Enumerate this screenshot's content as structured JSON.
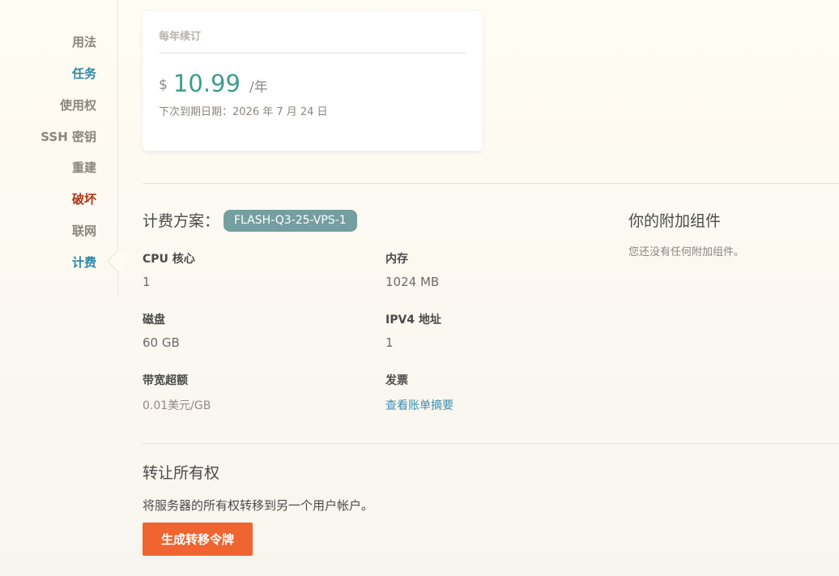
{
  "sidebar": {
    "items": [
      {
        "label": "用法",
        "color": "#8b857c"
      },
      {
        "label": "任务",
        "color": "#2d87a8"
      },
      {
        "label": "使用权",
        "color": "#8b857c"
      },
      {
        "label": "SSH 密钥",
        "color": "#8b857c"
      },
      {
        "label": "重建",
        "color": "#8b857c"
      },
      {
        "label": "破坏",
        "color": "#ac3414"
      },
      {
        "label": "联网",
        "color": "#8b857c"
      },
      {
        "label": "计费",
        "color": "#2d87a8",
        "active": true
      }
    ]
  },
  "renewal": {
    "title": "每年续订",
    "currency": "$",
    "amount": "10.99",
    "unit": "/年",
    "next_due": "下次到期日期：2026 年 7 月 24 日"
  },
  "plan": {
    "heading": "计费方案：",
    "name": "FLASH-Q3-25-VPS-1",
    "specs": {
      "cpu": {
        "label": "CPU 核心",
        "value": "1"
      },
      "memory": {
        "label": "内存",
        "value": "1024 MB"
      },
      "disk": {
        "label": "磁盘",
        "value": "60 GB"
      },
      "ipv4": {
        "label": "IPV4 地址",
        "value": "1"
      },
      "bandwidth": {
        "label": "带宽超额",
        "value": "0.01美元/GB"
      },
      "invoice": {
        "label": "发票",
        "link": "查看账单摘要"
      }
    }
  },
  "addons": {
    "heading": "你的附加组件",
    "empty_text": "您还没有任何附加组件。"
  },
  "transfer": {
    "heading": "转让所有权",
    "description": "将服务器的所有权转移到另一个用户帐户。",
    "button_label": "生成转移令牌",
    "button_color": "#ef6430"
  }
}
